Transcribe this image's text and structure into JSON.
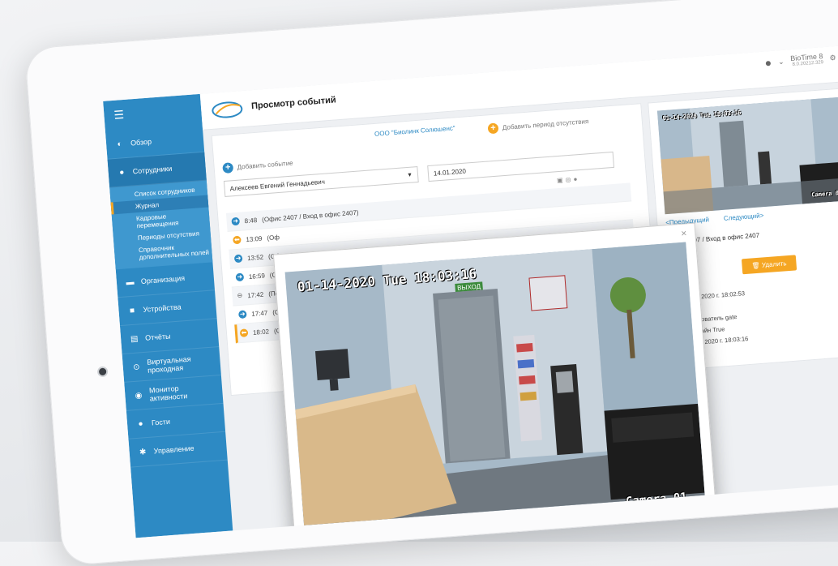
{
  "app": {
    "brand": "BioTime",
    "product": "BioTime 8",
    "version": "8.0.20212.329",
    "page_title": "Просмотр событий"
  },
  "sidebar": {
    "items": [
      {
        "label": "Обзор",
        "icon": "dashboard-icon"
      },
      {
        "label": "Сотрудники",
        "icon": "person-icon"
      },
      {
        "label": "Организация",
        "icon": "building-icon"
      },
      {
        "label": "Устройства",
        "icon": "device-icon"
      },
      {
        "label": "Отчёты",
        "icon": "report-icon"
      },
      {
        "label": "Виртуальная проходная",
        "icon": "gate-icon"
      },
      {
        "label": "Монитор активности",
        "icon": "monitor-icon"
      },
      {
        "label": "Гости",
        "icon": "guest-icon"
      },
      {
        "label": "Управление",
        "icon": "gear-icon"
      }
    ],
    "subitems": [
      "Список сотрудников",
      "Журнал",
      "Кадровые перемещения",
      "Периоды отсутствия",
      "Справочник дополнительных полей"
    ]
  },
  "events_panel": {
    "org_link": "ООО \"Биолинк Солюшенс\"",
    "add_absence": "Добавить период отсутствия",
    "add_event": "Добавить событие",
    "employee": "Алексеев Евгений Геннадьевич",
    "date": "14.01.2020",
    "events": [
      {
        "time": "8:48",
        "text": "(Офис 2407 / Вход в офис 2407)",
        "kind": "in"
      },
      {
        "time": "13:09",
        "text": "(Оф",
        "kind": "out"
      },
      {
        "time": "13:52",
        "text": "(Офи",
        "kind": "in"
      },
      {
        "time": "16:59",
        "text": "(Оф",
        "kind": "in"
      },
      {
        "time": "17:42",
        "text": "(Перем",
        "kind": "plain"
      },
      {
        "time": "17:47",
        "text": "(Офи",
        "kind": "in"
      },
      {
        "time": "18:02",
        "text": "(Оф",
        "kind": "out"
      }
    ]
  },
  "detail_panel": {
    "prev": "<Предыдущий",
    "next": "Следующий>",
    "location": "Офис 2407 / Вход в офис 2407",
    "delete_label": "Удалить",
    "info": [
      "14 января 2020 г. 18:02:53",
      "ход",
      "тип Пользователь gate",
      "жиме онлайн True",
      "14 января 2020 г. 18:03:16"
    ]
  },
  "camera": {
    "timestamp": "01-14-2020 Tue 18:03:16",
    "thumb_timestamp": "01-14-2020 Tue 18:03:16",
    "label": "Camera 01",
    "exit_sign": "ВЫХОД"
  },
  "colors": {
    "sidebar": "#2d8ac4",
    "accent_orange": "#f5a623",
    "link_blue": "#2d8ac4"
  }
}
